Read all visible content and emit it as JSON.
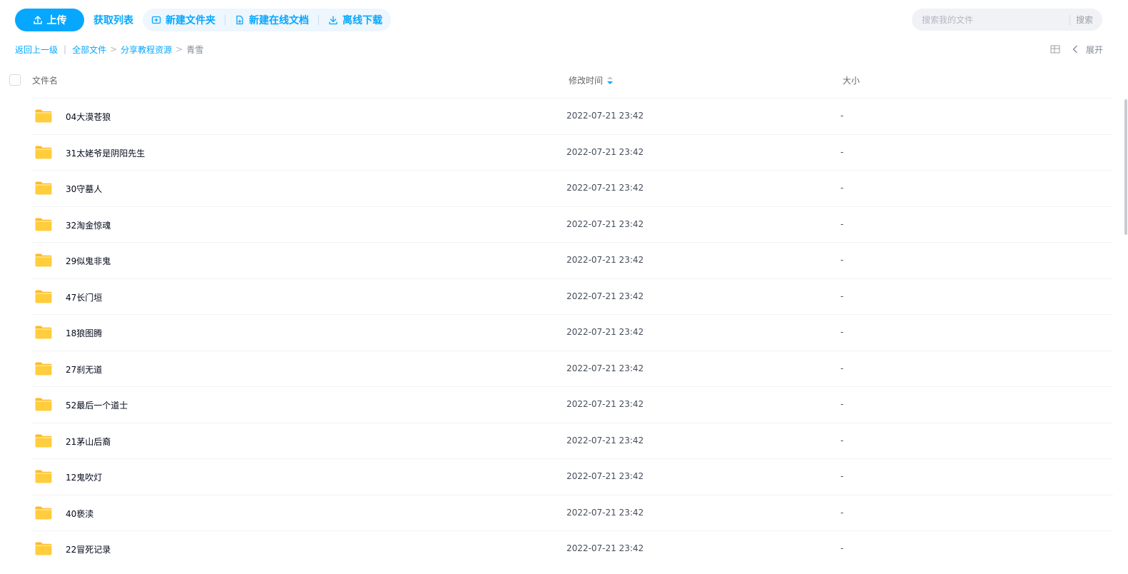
{
  "toolbar": {
    "upload_label": "上传",
    "fetch_list_label": "获取列表",
    "new_folder_label": "新建文件夹",
    "new_doc_label": "新建在线文档",
    "offline_download_label": "离线下载"
  },
  "search": {
    "placeholder": "搜索我的文件",
    "button_label": "搜索"
  },
  "breadcrumb": {
    "back_label": "返回上一级",
    "separator": "|",
    "items": [
      "全部文件",
      "分享教程资源"
    ],
    "current": "青雪",
    "arrow": ">"
  },
  "view": {
    "expand_label": "展开",
    "grid_icon": "grid-view-icon",
    "collapse_icon": "chevron-left-icon"
  },
  "table": {
    "columns": {
      "name": "文件名",
      "modified": "修改时间",
      "size": "大小"
    },
    "rows": [
      {
        "name": "04大漠苍狼",
        "modified": "2022-07-21 23:42",
        "size": "-"
      },
      {
        "name": "31太姥爷是阴阳先生",
        "modified": "2022-07-21 23:42",
        "size": "-"
      },
      {
        "name": "30守墓人",
        "modified": "2022-07-21 23:42",
        "size": "-"
      },
      {
        "name": "32淘金惊魂",
        "modified": "2022-07-21 23:42",
        "size": "-"
      },
      {
        "name": "29似鬼非鬼",
        "modified": "2022-07-21 23:42",
        "size": "-"
      },
      {
        "name": "47长门垣",
        "modified": "2022-07-21 23:42",
        "size": "-"
      },
      {
        "name": "18狼图腾",
        "modified": "2022-07-21 23:42",
        "size": "-"
      },
      {
        "name": "27刹无道",
        "modified": "2022-07-21 23:42",
        "size": "-"
      },
      {
        "name": "52最后一个道士",
        "modified": "2022-07-21 23:42",
        "size": "-"
      },
      {
        "name": "21茅山后裔",
        "modified": "2022-07-21 23:42",
        "size": "-"
      },
      {
        "name": "12鬼吹灯",
        "modified": "2022-07-21 23:42",
        "size": "-"
      },
      {
        "name": "40亵渎",
        "modified": "2022-07-21 23:42",
        "size": "-"
      },
      {
        "name": "22冒死记录",
        "modified": "2022-07-21 23:42",
        "size": "-"
      }
    ]
  },
  "colors": {
    "accent": "#06a7ff",
    "toolbar_group_bg": "#eef6fe",
    "search_bg": "#f1f2f6",
    "folder_yellow": "#ffc736"
  }
}
